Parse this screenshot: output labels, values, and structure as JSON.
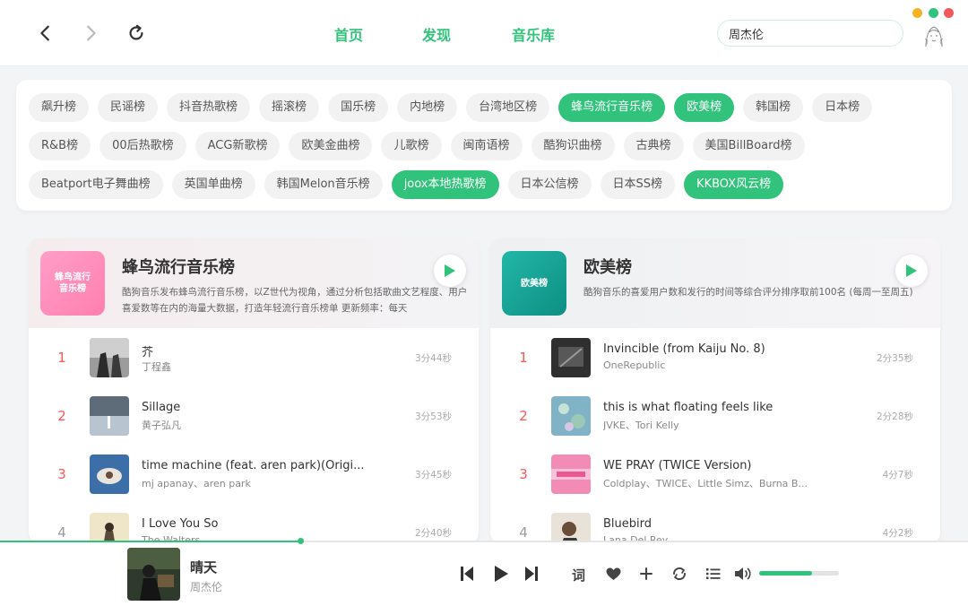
{
  "header": {
    "back_icon": "chevron-left-icon",
    "forward_icon": "chevron-right-icon",
    "refresh_icon": "refresh-icon",
    "tabs": [
      {
        "label": "首页"
      },
      {
        "label": "发现"
      },
      {
        "label": "音乐库"
      }
    ],
    "search_value": "周杰伦",
    "traffic_colors": [
      "#f5b324",
      "#31c27c",
      "#f25a5a"
    ],
    "accent_color": "#31c27c"
  },
  "tags": [
    {
      "label": "飙升榜",
      "active": false
    },
    {
      "label": "民谣榜",
      "active": false
    },
    {
      "label": "抖音热歌榜",
      "active": false
    },
    {
      "label": "摇滚榜",
      "active": false
    },
    {
      "label": "国乐榜",
      "active": false
    },
    {
      "label": "内地榜",
      "active": false
    },
    {
      "label": "台湾地区榜",
      "active": false
    },
    {
      "label": "蜂鸟流行音乐榜",
      "active": true
    },
    {
      "label": "欧美榜",
      "active": true
    },
    {
      "label": "韩国榜",
      "active": false
    },
    {
      "label": "日本榜",
      "active": false
    },
    {
      "label": "R&B榜",
      "active": false
    },
    {
      "label": "00后热歌榜",
      "active": false
    },
    {
      "label": "ACG新歌榜",
      "active": false
    },
    {
      "label": "欧美金曲榜",
      "active": false
    },
    {
      "label": "儿歌榜",
      "active": false
    },
    {
      "label": "闽南语榜",
      "active": false
    },
    {
      "label": "酷狗识曲榜",
      "active": false
    },
    {
      "label": "古典榜",
      "active": false
    },
    {
      "label": "美国BillBoard榜",
      "active": false
    },
    {
      "label": "Beatport电子舞曲榜",
      "active": false
    },
    {
      "label": "英国单曲榜",
      "active": false
    },
    {
      "label": "韩国Melon音乐榜",
      "active": false
    },
    {
      "label": "joox本地热歌榜",
      "active": true
    },
    {
      "label": "日本公信榜",
      "active": false
    },
    {
      "label": "日本SS榜",
      "active": false
    },
    {
      "label": "KKBOX风云榜",
      "active": true
    }
  ],
  "charts": [
    {
      "title": "蜂鸟流行音乐榜",
      "cover_text": "蜂鸟流行音乐榜",
      "description": "酷狗音乐发布蜂鸟流行音乐榜，以Z世代为视角，通过分析包括歌曲文艺程度、用户喜爱数等在内的海量大数据，打造年轻流行音乐榜单 更新频率：每天",
      "songs": [
        {
          "rank": "1",
          "name": "芥",
          "artist": "丁程鑫",
          "duration": "3分44秒"
        },
        {
          "rank": "2",
          "name": "Sillage",
          "artist": "黄子弘凡",
          "duration": "3分53秒"
        },
        {
          "rank": "3",
          "name": "time machine (feat. aren park)(Origi...",
          "artist": "mj apanay、aren park",
          "duration": "3分45秒"
        },
        {
          "rank": "4",
          "name": "I Love You So",
          "artist": "The Walters",
          "duration": "2分40秒"
        }
      ]
    },
    {
      "title": "欧美榜",
      "cover_text": "欧美榜",
      "description": "酷狗音乐的喜爱用户数和发行的时间等综合评分排序取前100名 (每周一至周五)",
      "songs": [
        {
          "rank": "1",
          "name": "Invincible (from Kaiju No. 8)",
          "artist": "OneRepublic",
          "duration": "2分35秒"
        },
        {
          "rank": "2",
          "name": "this is what floating feels like",
          "artist": "JVKE、Tori Kelly",
          "duration": "2分28秒"
        },
        {
          "rank": "3",
          "name": "WE PRAY (TWICE Version)",
          "artist": "Coldplay、TWICE、Little Simz、Burna B...",
          "duration": "4分7秒"
        },
        {
          "rank": "4",
          "name": "Bluebird",
          "artist": "Lana Del Rey",
          "duration": "4分2秒"
        }
      ]
    }
  ],
  "player": {
    "title": "晴天",
    "artist": "周杰伦",
    "progress": 0.31,
    "volume": 0.66,
    "lyric_label": "词",
    "icons": [
      "skip-previous-icon",
      "play-icon",
      "skip-next-icon",
      "heart-icon",
      "plus-icon",
      "repeat-icon",
      "playlist-icon",
      "volume-icon"
    ]
  }
}
